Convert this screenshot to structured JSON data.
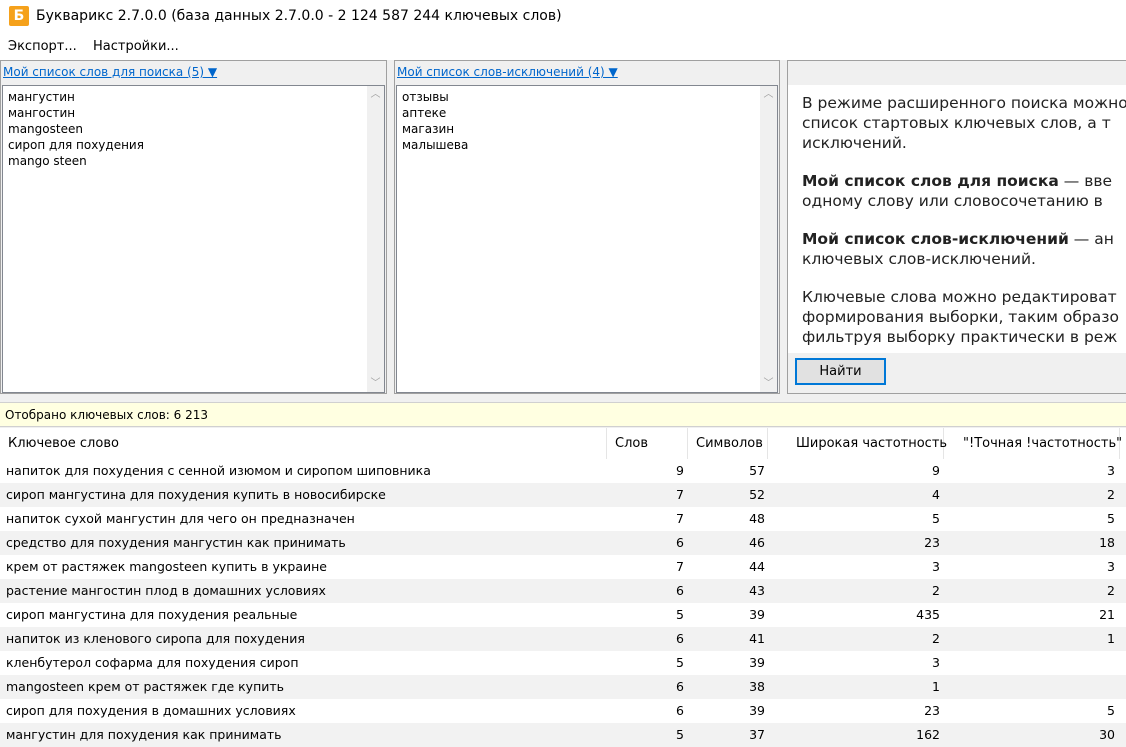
{
  "window": {
    "title": "Букварикс 2.7.0.0 (база данных 2.7.0.0 - 2 124 587 244 ключевых слов)",
    "icon_letter": "Б"
  },
  "menu": {
    "export": "Экспорт...",
    "settings": "Настройки..."
  },
  "search_list": {
    "header": "Мой список слов для поиска (5) ▼",
    "items": [
      "мангустин",
      "мангостин",
      "mangosteen",
      "сироп для похудения",
      "mango steen"
    ]
  },
  "exclude_list": {
    "header": "Мой список слов-исключений (4) ▼",
    "items": [
      "отзывы",
      "аптеке",
      "магазин",
      "малышева"
    ]
  },
  "info": {
    "p1_lines": [
      "В режиме расширенного поиска можно",
      "список стартовых ключевых слов, а т",
      "исключений."
    ],
    "p2_bold": "Мой список слов для поиска",
    "p2_rest1": " — вве",
    "p2_line2": "одному слову или словосочетанию в",
    "p3_bold": "Мой список слов-исключений",
    "p3_rest1": " — ан",
    "p3_line2": "ключевых слов-исключений.",
    "p4_lines": [
      "Ключевые слова можно редактироват",
      "формирования выборки, таким образо",
      "фильтруя выборку практически в реж"
    ]
  },
  "find_button": "Найти",
  "status": "Отобрано ключевых слов: 6 213",
  "table": {
    "columns": [
      "Ключевое слово",
      "Слов",
      "Символов",
      "Широкая частотность",
      "\"!Точная !частотность\""
    ],
    "rows": [
      [
        "напиток для похудения с сенной изюмом и сиропом шиповника",
        "9",
        "57",
        "9",
        "3"
      ],
      [
        "сироп мангустина для похудения купить в новосибирске",
        "7",
        "52",
        "4",
        "2"
      ],
      [
        "напиток сухой мангустин для чего он предназначен",
        "7",
        "48",
        "5",
        "5"
      ],
      [
        "средство для похудения мангустин как принимать",
        "6",
        "46",
        "23",
        "18"
      ],
      [
        "крем от растяжек mangosteen купить в украине",
        "7",
        "44",
        "3",
        "3"
      ],
      [
        "растение мангостин плод в домашних условиях",
        "6",
        "43",
        "2",
        "2"
      ],
      [
        "сироп мангустина для похудения реальные",
        "5",
        "39",
        "435",
        "21"
      ],
      [
        "напиток из кленового сиропа для похудения",
        "6",
        "41",
        "2",
        "1"
      ],
      [
        "кленбутерол софарма для похудения сироп",
        "5",
        "39",
        "3",
        ""
      ],
      [
        "mangosteen крем от растяжек где купить",
        "6",
        "38",
        "1",
        ""
      ],
      [
        "сироп для похудения в домашних условиях",
        "6",
        "39",
        "23",
        "5"
      ],
      [
        "мангустин для похудения как принимать",
        "5",
        "37",
        "162",
        "30"
      ]
    ]
  }
}
